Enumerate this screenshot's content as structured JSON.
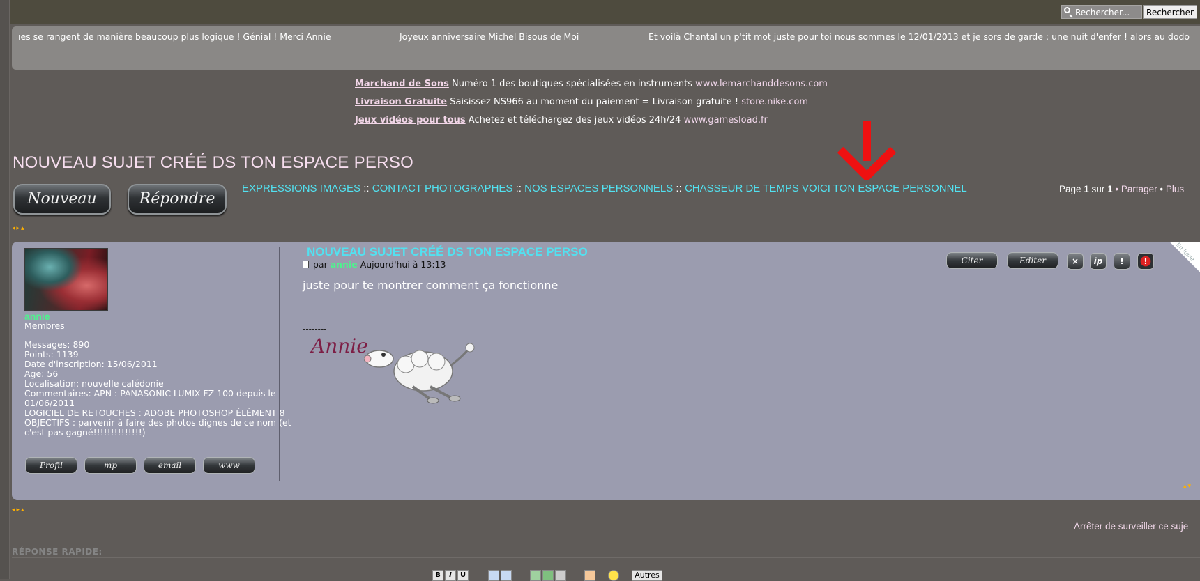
{
  "search": {
    "placeholder_button": "Rechercher...",
    "submit": "Rechercher"
  },
  "ticker": [
    "ıes se rangent de manière beaucoup plus logique ! Génial ! Merci Annie",
    "Joyeux anniversaire Michel Bisous de Moi",
    "Et voilà Chantal un p'tit mot juste pour toi nous sommes le 12/01/2013 et je sors de garde : une nuit d'enfer ! alors au dodo"
  ],
  "ads": [
    {
      "title": "Marchand de Sons",
      "text": " Numéro 1 des boutiques spécialisées en instruments ",
      "url": "www.lemarchanddesons.com"
    },
    {
      "title": "Livraison Gratuite",
      "text": " Saisissez NS966 au moment du paiement = Livraison gratuite ! ",
      "url": "store.nike.com"
    },
    {
      "title": "Jeux vidéos pour tous",
      "text": " Achetez et téléchargez des jeux vidéos 24h/24 ",
      "url": "www.gamesload.fr"
    }
  ],
  "page_title": "NOUVEAU SUJET CRÉÉ DS TON ESPACE PERSO",
  "buttons": {
    "new": "Nouveau",
    "reply": "Répondre"
  },
  "breadcrumb": {
    "items": [
      "EXPRESSIONS IMAGES",
      "CONTACT PHOTOGRAPHES",
      "NOS ESPACES PERSONNELS",
      "CHASSEUR DE TEMPS VOICI TON ESPACE PERSONNEL"
    ],
    "separator": "::"
  },
  "pager": {
    "prefix": "Page ",
    "current": "1",
    "middle": " sur ",
    "total": "1",
    "bullet": " • ",
    "share": "Partager",
    "more": "Plus"
  },
  "post": {
    "title": "NOUVEAU SUJET CRÉÉ DS TON ESPACE PERSO",
    "by": "par ",
    "author": "annie",
    "date": " Aujourd'hui à 13:13",
    "body": "juste pour te montrer comment ça fonctionne",
    "sig_separator": "--------",
    "sig_name": "Annie",
    "actions": {
      "quote": "Citer",
      "edit": "Editer",
      "delete": "×",
      "ip": "ip",
      "report": "!",
      "warn": "!"
    },
    "corner": "En ligne"
  },
  "user": {
    "name": "annie",
    "rank": "Membres",
    "info": [
      "Messages: 890",
      "Points: 1139",
      "Date d'inscription: 15/06/2011",
      "Age: 56",
      "Localisation: nouvelle calédonie",
      "Commentaires: APN : PANASONIC LUMIX FZ 100 depuis le 01/06/2011",
      "LOGICIEL DE RETOUCHES : ADOBE PHOTOSHOP ÉLÉMENT 8",
      "OBJECTIFS : parvenir à faire des photos dignes de ce nom (et c'est pas gagné!!!!!!!!!!!!!!)"
    ],
    "buttons": {
      "profile": "Profil",
      "pm": "mp",
      "email": "email",
      "www": "www"
    }
  },
  "unwatch": "Arrêter de surveiller ce suje",
  "quick_reply": "RÉPONSE RAPIDE:",
  "toolbar": {
    "bold": "B",
    "italic": "I",
    "underline": "U",
    "others": "Autres"
  },
  "colors": {
    "link_cyan": "#52e1f0",
    "link_pink": "#f2d8ea",
    "author_green": "#4ff28e",
    "arrow_red": "#ee1111"
  }
}
